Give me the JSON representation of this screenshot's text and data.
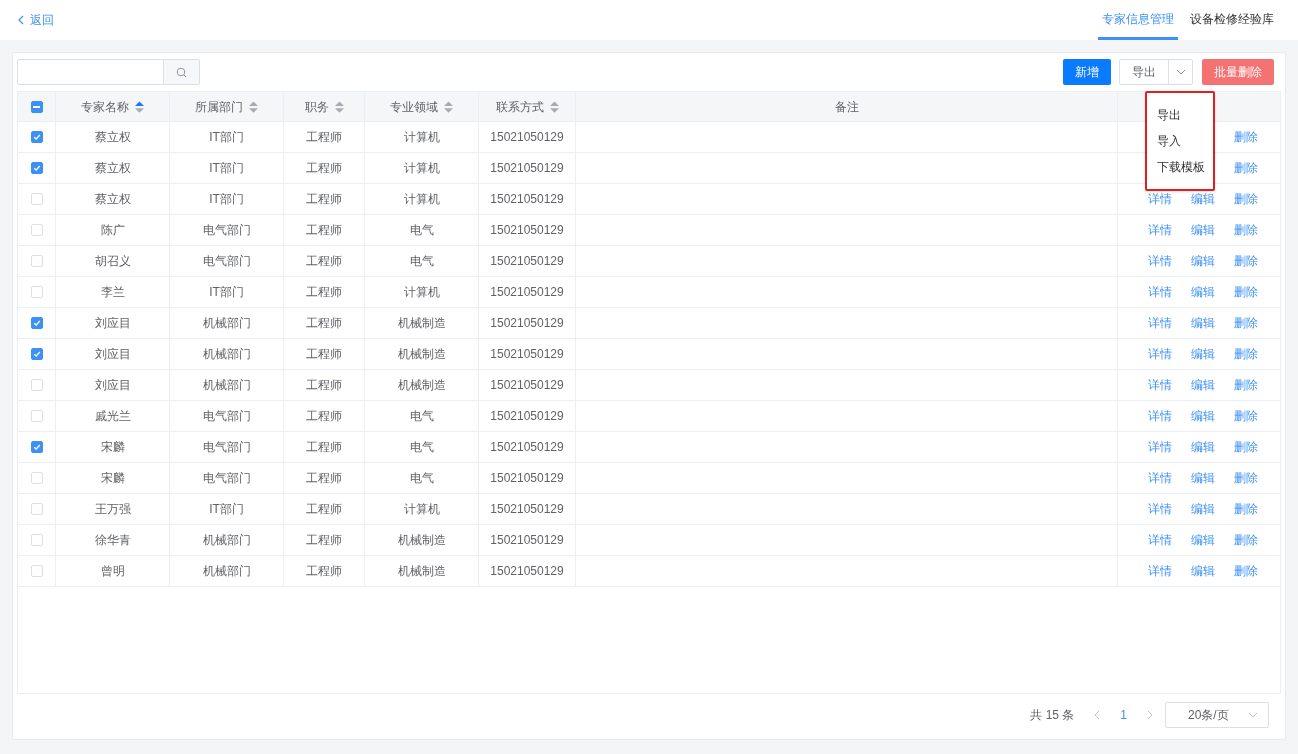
{
  "back_link": {
    "label": "返回"
  },
  "tabs": [
    {
      "label": "专家信息管理",
      "selected": true
    },
    {
      "label": "设备检修经验库",
      "selected": false
    }
  ],
  "toolbar": {
    "add_button": "新增",
    "export_button": "导出",
    "batch_delete_button": "批量删除"
  },
  "export_menu": {
    "open": true,
    "items": [
      "导出",
      "导入",
      "下载模板"
    ]
  },
  "table": {
    "header_checkbox": {
      "indeterminate": true
    },
    "columns": [
      {
        "label": "专家名称",
        "sortable": true,
        "sorted_ascending": true
      },
      {
        "label": "所属部门",
        "sortable": true,
        "sorted_ascending": false
      },
      {
        "label": "职务",
        "sortable": true,
        "sorted_ascending": false
      },
      {
        "label": "专业领域",
        "sortable": true,
        "sorted_ascending": false
      },
      {
        "label": "联系方式",
        "sortable": true,
        "sorted_ascending": false
      },
      {
        "label": "备注",
        "sortable": false
      }
    ],
    "rows": [
      {
        "checked": true,
        "cells": [
          "蔡立权",
          "IT部门",
          "工程师",
          "计算机",
          "15021050129"
        ],
        "actions": [
          "删除"
        ]
      },
      {
        "checked": true,
        "cells": [
          "蔡立权",
          "IT部门",
          "工程师",
          "计算机",
          "15021050129"
        ],
        "actions": [
          "删除"
        ]
      },
      {
        "checked": false,
        "cells": [
          "蔡立权",
          "IT部门",
          "工程师",
          "计算机",
          "15021050129"
        ],
        "actions": [
          "详情",
          "编辑",
          "删除"
        ]
      },
      {
        "checked": false,
        "cells": [
          "陈广",
          "电气部门",
          "工程师",
          "电气",
          "15021050129"
        ],
        "actions": [
          "详情",
          "编辑",
          "删除"
        ]
      },
      {
        "checked": false,
        "cells": [
          "胡召义",
          "电气部门",
          "工程师",
          "电气",
          "15021050129"
        ],
        "actions": [
          "详情",
          "编辑",
          "删除"
        ]
      },
      {
        "checked": false,
        "cells": [
          "李兰",
          "IT部门",
          "工程师",
          "计算机",
          "15021050129"
        ],
        "actions": [
          "详情",
          "编辑",
          "删除"
        ]
      },
      {
        "checked": true,
        "cells": [
          "刘应目",
          "机械部门",
          "工程师",
          "机械制造",
          "15021050129"
        ],
        "actions": [
          "详情",
          "编辑",
          "删除"
        ]
      },
      {
        "checked": true,
        "cells": [
          "刘应目",
          "机械部门",
          "工程师",
          "机械制造",
          "15021050129"
        ],
        "actions": [
          "详情",
          "编辑",
          "删除"
        ]
      },
      {
        "checked": false,
        "cells": [
          "刘应目",
          "机械部门",
          "工程师",
          "机械制造",
          "15021050129"
        ],
        "actions": [
          "详情",
          "编辑",
          "删除"
        ]
      },
      {
        "checked": false,
        "cells": [
          "戚光兰",
          "电气部门",
          "工程师",
          "电气",
          "15021050129"
        ],
        "actions": [
          "详情",
          "编辑",
          "删除"
        ]
      },
      {
        "checked": true,
        "cells": [
          "宋麟",
          "电气部门",
          "工程师",
          "电气",
          "15021050129"
        ],
        "actions": [
          "详情",
          "编辑",
          "删除"
        ]
      },
      {
        "checked": false,
        "cells": [
          "宋麟",
          "电气部门",
          "工程师",
          "电气",
          "15021050129"
        ],
        "actions": [
          "详情",
          "编辑",
          "删除"
        ]
      },
      {
        "checked": false,
        "cells": [
          "王万强",
          "IT部门",
          "工程师",
          "计算机",
          "15021050129"
        ],
        "actions": [
          "详情",
          "编辑",
          "删除"
        ]
      },
      {
        "checked": false,
        "cells": [
          "徐华青",
          "机械部门",
          "工程师",
          "机械制造",
          "15021050129"
        ],
        "actions": [
          "详情",
          "编辑",
          "删除"
        ]
      },
      {
        "checked": false,
        "cells": [
          "曾明",
          "机械部门",
          "工程师",
          "机械制造",
          "15021050129"
        ],
        "actions": [
          "详情",
          "编辑",
          "删除"
        ]
      }
    ]
  },
  "pagination": {
    "total": "共 15 条",
    "pages": [
      {
        "label": "1",
        "selected": true
      }
    ],
    "page_size": "20条/页"
  }
}
